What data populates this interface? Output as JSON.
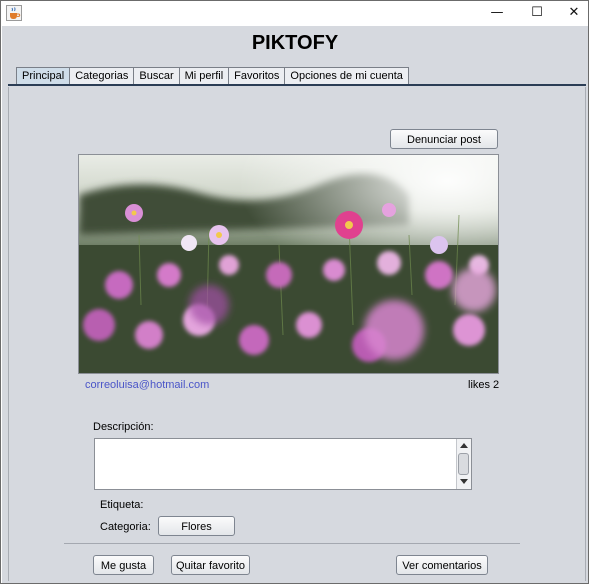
{
  "window": {
    "title": "",
    "app_icon": "java-cup-icon",
    "controls": {
      "minimize": "—",
      "maximize": "☐",
      "close": "✕"
    }
  },
  "app_title": "PIKTOFY",
  "tabs": [
    {
      "label": "Principal",
      "active": true
    },
    {
      "label": "Categorias",
      "active": false
    },
    {
      "label": "Buscar",
      "active": false
    },
    {
      "label": "Mi perfil",
      "active": false
    },
    {
      "label": "Favoritos",
      "active": false
    },
    {
      "label": "Opciones de mi cuenta",
      "active": false
    }
  ],
  "post": {
    "report_label": "Denunciar post",
    "author_email": "correoluisa@hotmail.com",
    "likes_label": "likes",
    "likes_count": "2",
    "image_subject": "pink-cosmos-flowers-field-photo",
    "description_label": "Descripción:",
    "description_value": "",
    "tag_label": "Etiqueta:",
    "tag_value": "",
    "category_label": "Categoria:",
    "category_value": "Flores"
  },
  "actions": {
    "like_label": "Me gusta",
    "unfavorite_label": "Quitar favorito",
    "comments_label": "Ver comentarios"
  },
  "colors": {
    "panel_bg": "#d6d9df",
    "active_tab": "#cfdde9",
    "link_text": "#4a55c8"
  }
}
